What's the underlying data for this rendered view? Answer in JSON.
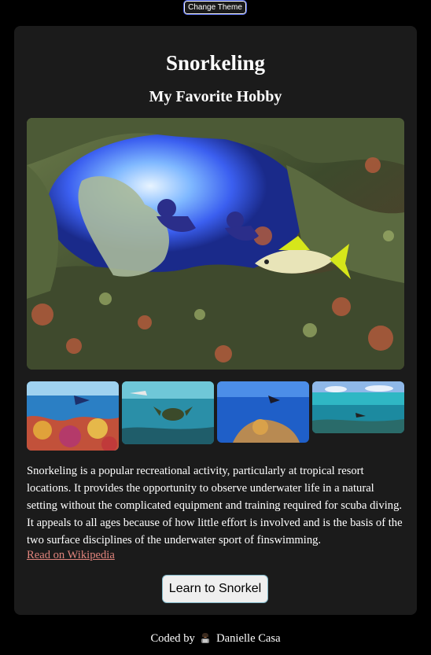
{
  "header": {
    "theme_button": "Change Theme"
  },
  "card": {
    "title": "Snorkeling",
    "subtitle": "My Favorite Hobby",
    "description": "Snorkeling is a popular recreational activity, particularly at tropical resort locations. It provides the opportunity to observe underwater life in a natural setting without the complicated equipment and training required for scuba diving. It appeals to all ages because of how little effort is involved and is the basis of the two surface disciplines of the underwater sport of finswimming.",
    "link_label": "Read on Wikipedia",
    "cta_label": "Learn to Snorkel"
  },
  "footer": {
    "prefix": "Coded by",
    "author": "Danielle Casa",
    "avatar_icon": "person-with-laptop-emoji"
  },
  "colors": {
    "page_bg": "#000000",
    "card_bg": "#1b1b1b",
    "link": "#e0847c",
    "button_bg": "#efefef"
  }
}
